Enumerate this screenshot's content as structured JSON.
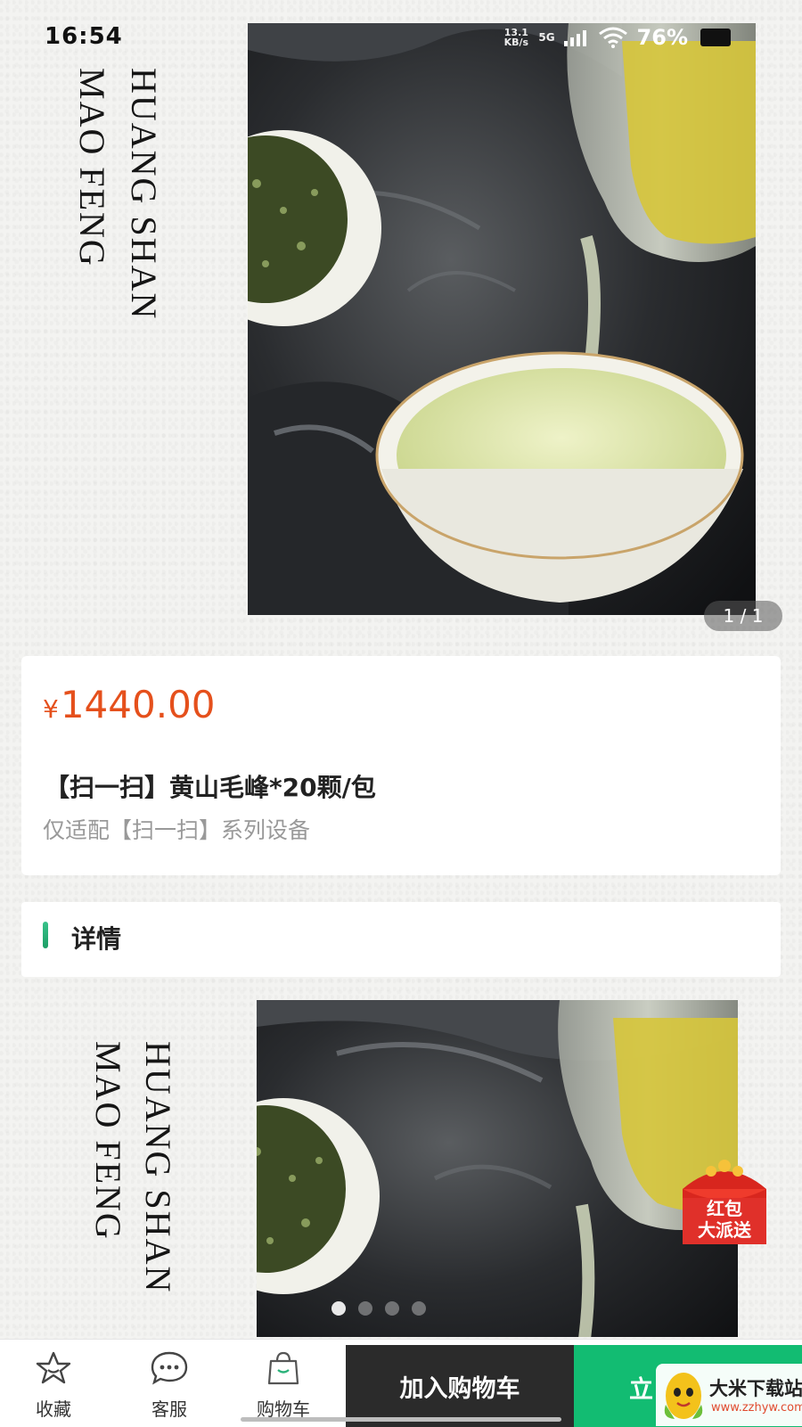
{
  "status_bar": {
    "time": "16:54",
    "net_speed": "13.1 KB/s",
    "network": "5G",
    "battery": "76%"
  },
  "hero": {
    "title_line1": "HUANG SHAN",
    "title_line2": "MAO FENG",
    "image_counter": "1 / 1"
  },
  "product": {
    "currency": "¥",
    "price": "1440.00",
    "title": "【扫一扫】黄山毛峰*20颗/包",
    "subtitle": "仅适配【扫一扫】系列设备"
  },
  "details": {
    "heading": "详情",
    "image_title_line1": "HUANG SHAN",
    "image_title_line2": "MAO FENG",
    "carousel_dots": 4,
    "active_dot": 0
  },
  "floating_badge": {
    "label_line1": "红包",
    "label_line2": "大派送"
  },
  "bottom_bar": {
    "favorite_label": "收藏",
    "service_label": "客服",
    "cart_label": "购物车",
    "add_to_cart_label": "加入购物车",
    "buy_now_label": "立"
  },
  "watermark": {
    "name": "大米下载站",
    "url": "www.zzhyw.com"
  },
  "colors": {
    "price": "#e5501c",
    "buy_button": "#12bc72",
    "add_cart_button": "#2b2b2b",
    "accent": "#2bb27a"
  }
}
